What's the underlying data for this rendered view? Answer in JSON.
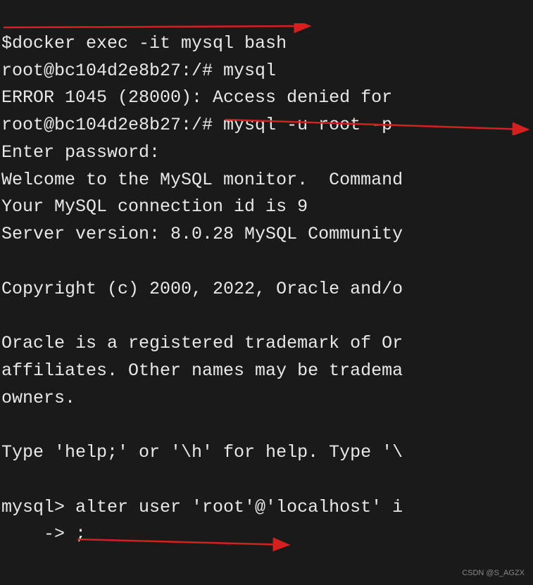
{
  "terminal": {
    "lines": [
      "$docker exec -it mysql bash",
      "root@bc104d2e8b27:/# mysql",
      "ERROR 1045 (28000): Access denied for ",
      "root@bc104d2e8b27:/# mysql -u root -p ",
      "Enter password: ",
      "Welcome to the MySQL monitor.  Command",
      "Your MySQL connection id is 9",
      "Server version: 8.0.28 MySQL Community",
      "",
      "Copyright (c) 2000, 2022, Oracle and/o",
      "",
      "Oracle is a registered trademark of Or",
      "affiliates. Other names may be tradema",
      "owners.",
      "",
      "Type 'help;' or '\\h' for help. Type '\\",
      "",
      "mysql> alter user 'root'@'localhost' i",
      "    -> ;"
    ]
  },
  "watermark": {
    "text": "CSDN @S_AGZX"
  }
}
